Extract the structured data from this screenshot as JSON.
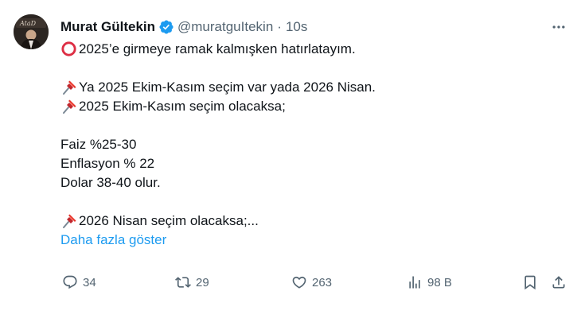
{
  "author": {
    "display_name": "Murat Gültekin",
    "handle": "@muratguItekin",
    "separator": "·",
    "time": "10s",
    "verified_icon": "verified-badge-icon",
    "avatar_text": "AtaD"
  },
  "tweet": {
    "lines": [
      "2025’e girmeye ramak kalmışken hatırlatayım.",
      "Ya 2025 Ekim-Kasım seçim var yada 2026 Nisan.",
      "2025 Ekim-Kasım seçim olacaksa;",
      "Faiz %25-30",
      "Enflasyon % 22",
      "Dolar 38-40 olur.",
      "2026 Nisan seçim olacaksa;..."
    ],
    "show_more": "Daha fazla göster"
  },
  "actions": {
    "replies": "34",
    "reposts": "29",
    "likes": "263",
    "views": "98 B"
  },
  "colors": {
    "accent": "#1d9bf0",
    "muted": "#536471",
    "text": "#0f1419",
    "pin": "#e5342b",
    "circle": "#dd2e44"
  }
}
